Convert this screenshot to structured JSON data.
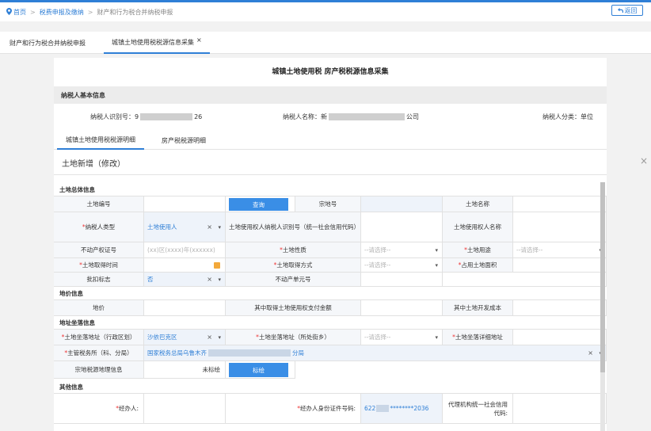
{
  "breadcrumb": {
    "home": "首页",
    "level1": "税费申报及缴纳",
    "level2": "财产和行为税合并纳税申报",
    "separator": ">"
  },
  "back_button": "返回",
  "tabs": [
    {
      "label": "财产和行为税合并纳税申报"
    },
    {
      "label": "城镇土地使用税税源信息采集",
      "close": "×"
    }
  ],
  "page_title": "城镇土地使用税 房产税税源信息采集",
  "taxpayer_section": {
    "heading": "纳税人基本信息",
    "id_label": "纳税人识别号：",
    "id_prefix": "9",
    "id_suffix": "26",
    "name_label": "纳税人名称：",
    "name_prefix": "新",
    "name_suffix": "公司",
    "category_label": "纳税人分类：",
    "category_value": "单位"
  },
  "sub_tabs": [
    "城镇土地使用税税源明细",
    "房产税税源明细"
  ],
  "dialog": {
    "title": "土地新增（修改）",
    "close": "×"
  },
  "form": {
    "group_total": "土地总体信息",
    "land_no_label": "土地编号",
    "query_button": "查询",
    "parcel_no_label": "宗地号",
    "land_name_label": "土地名称",
    "taxpayer_type_label": "纳税人类型",
    "taxpayer_type_value": "土地使用人",
    "user_id_label": "土地使用权人纳税人识别号（统一社会信用代码）",
    "user_name_label": "土地使用权人名称",
    "property_cert_label": "不动产权证号",
    "property_cert_placeholder": "(xx)区(xxxx)年(xxxxxx)",
    "land_nature_label": "土地性质",
    "select_placeholder": "--请选择--",
    "land_use_label": "土地用途",
    "acquire_time_label": "土地取得时间",
    "acquire_method_label": "土地取得方式",
    "area_label": "占用土地面积",
    "approval_label": "批扣标志",
    "approval_value": "否",
    "unit_no_label": "不动产单元号",
    "group_price": "地价信息",
    "price_label": "地价",
    "paid_label": "其中取得土地使用权支付金额",
    "dev_cost_label": "其中土地开发成本",
    "group_address": "地址坐落信息",
    "district_label": "土地坐落地址（行政区划）",
    "district_value": "沙依巴克区",
    "street_label": "土地坐落地址（所处街乡）",
    "detail_addr_label": "土地坐落详细地址",
    "tax_office_label": "主管税务所（科、分局）",
    "tax_office_prefix": "国家税务总局乌鲁木齐",
    "tax_office_suffix": "分局",
    "geo_label": "宗地税源地理信息",
    "geo_status": "未标绘",
    "geo_button": "标绘",
    "group_other": "其他信息",
    "handler_label": "经办人:",
    "handler_id_label": "经办人身份证件号码:",
    "handler_id_prefix": "622",
    "handler_id_suffix": "********2036",
    "agency_label": "代理机构统一社会信用代码:"
  },
  "colors": {
    "accent": "#2f7fd6",
    "required": "#e33333",
    "button": "#3a8ee6"
  }
}
